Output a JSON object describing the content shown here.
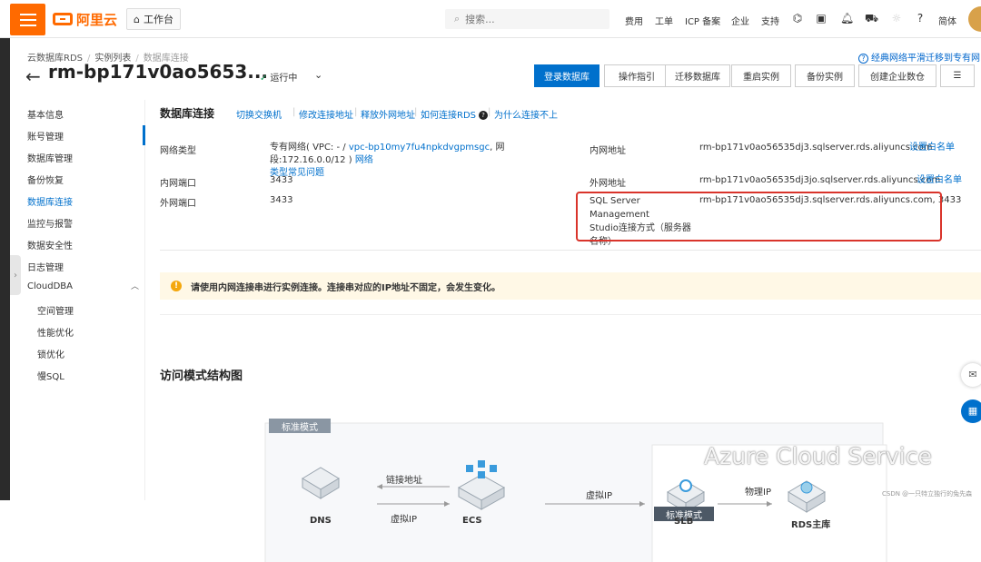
{
  "topbar": {
    "logo_text": "阿里云",
    "workbench": "工作台",
    "search_placeholder": "搜索...",
    "nav": [
      "费用",
      "工单",
      "ICP 备案",
      "企业",
      "支持"
    ],
    "lang": "简体"
  },
  "breadcrumb": [
    "云数据库RDS",
    "实例列表",
    "数据库连接"
  ],
  "instance": {
    "title": "rm-bp171v0ao5653...",
    "status": "运行中"
  },
  "top_link": "经典网络平滑迁移到专有网络",
  "toolbar": {
    "login": "登录数据库",
    "guide": "操作指引",
    "migrate": "迁移数据库",
    "restart": "重启实例",
    "backup": "备份实例",
    "create": "创建企业数仓"
  },
  "sidebar": {
    "items": [
      "基本信息",
      "账号管理",
      "数据库管理",
      "备份恢复",
      "数据库连接",
      "监控与报警",
      "数据安全性",
      "日志管理",
      "CloudDBA"
    ],
    "sub_items": [
      "空间管理",
      "性能优化",
      "锁优化",
      "慢SQL"
    ]
  },
  "connection": {
    "title": "数据库连接",
    "links": [
      "切换交换机",
      "修改连接地址",
      "释放外网地址",
      "如何连接RDS",
      "为什么连接不上"
    ],
    "network_type_label": "网络类型",
    "network_type_prefix": "专有网络( VPC: - / ",
    "network_vpc": "vpc-bp10my7fu4npkdvgpmsgc",
    "network_type_suffix": ", 网段:172.16.0.0/12 )",
    "network_faq": "网络",
    "network_faq2": "类型常见问题",
    "intranet_port_label": "内网端口",
    "intranet_port": "3433",
    "extranet_port_label": "外网端口",
    "extranet_port": "3433",
    "intranet_addr_label": "内网地址",
    "intranet_addr": "rm-bp171v0ao56535dj3.sqlserver.rds.aliyuncs.com",
    "intranet_whitelist": "设置白名单",
    "extranet_addr_label": "外网地址",
    "extranet_addr": "rm-bp171v0ao56535dj3jo.sqlserver.rds.aliyuncs.com",
    "extranet_whitelist": "设置白名单",
    "ssms_label_1": "SQL Server Management",
    "ssms_label_2": "Studio连接方式（服务器",
    "ssms_label_3": "名称）",
    "ssms_value": "rm-bp171v0ao56535dj3.sqlserver.rds.aliyuncs.com, 3433"
  },
  "notice": "请使用内网连接串进行实例连接。连接串对应的IP地址不固定，会发生变化。",
  "diagram": {
    "title": "访问模式结构图",
    "mode_tag_1": "标准模式",
    "mode_tag_2": "标准模式",
    "dns": "DNS",
    "ecs": "ECS",
    "slb": "SLB",
    "rds": "RDS主库",
    "edge_link_addr": "链接地址",
    "edge_vip_1": "虚拟IP",
    "edge_vip_2": "虚拟IP",
    "edge_phys_ip": "物理IP",
    "dns_badge": "DNS"
  },
  "watermark": "Azure Cloud Service",
  "csdn": "CSDN @一只特立独行的兔先森",
  "colors": {
    "accent": "#ff6a00",
    "primary": "#0070cc",
    "highlight": "#d9342b"
  }
}
